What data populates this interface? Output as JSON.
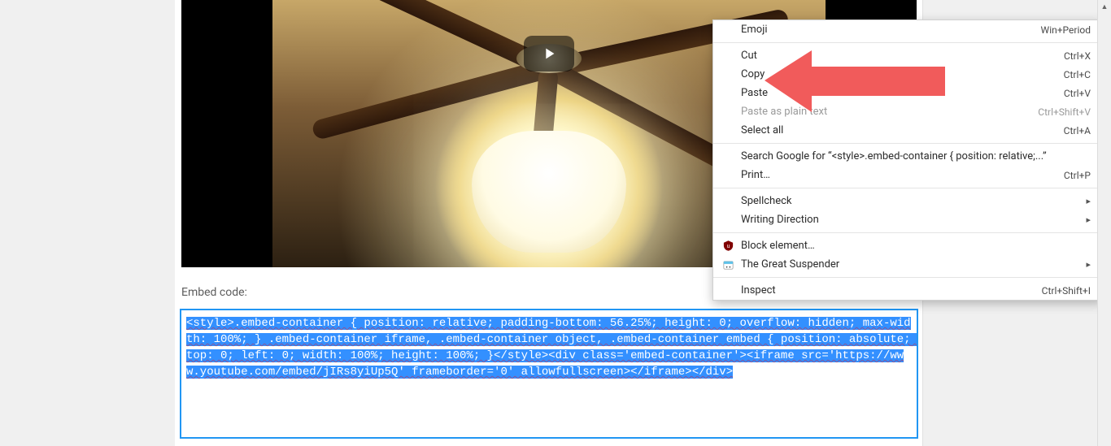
{
  "video": {
    "play_label": "Play"
  },
  "embed": {
    "label": "Embed code:",
    "code": "<style>.embed-container { position: relative; padding-bottom: 56.25%; height: 0; overflow: hidden; max-width: 100%; } .embed-container iframe, .embed-container object, .embed-container embed { position: absolute; top: 0; left: 0; width: 100%; height: 100%; }</style><div class='embed-container'><iframe src='https://www.youtube.com/embed/jIRs8yiUp5Q' frameborder='0' allowfullscreen></iframe></div>"
  },
  "context_menu": {
    "items": [
      {
        "label": "Emoji",
        "accelerator": "Win+Period",
        "interactable": true
      },
      {
        "separator": true
      },
      {
        "label": "Cut",
        "accelerator": "Ctrl+X",
        "interactable": true
      },
      {
        "label": "Copy",
        "accelerator": "Ctrl+C",
        "interactable": true
      },
      {
        "label": "Paste",
        "accelerator": "Ctrl+V",
        "interactable": true
      },
      {
        "label": "Paste as plain text",
        "accelerator": "Ctrl+Shift+V",
        "interactable": false,
        "disabled": true
      },
      {
        "label": "Select all",
        "accelerator": "Ctrl+A",
        "interactable": true
      },
      {
        "separator": true
      },
      {
        "label": "Search Google for “<style>.embed-container { position: relative;...”",
        "accelerator": "",
        "interactable": true
      },
      {
        "label": "Print…",
        "accelerator": "Ctrl+P",
        "interactable": true
      },
      {
        "separator": true
      },
      {
        "label": "Spellcheck",
        "accelerator": "",
        "interactable": true,
        "submenu": true
      },
      {
        "label": "Writing Direction",
        "accelerator": "",
        "interactable": true,
        "submenu": true
      },
      {
        "separator": true
      },
      {
        "label": "Block element…",
        "accelerator": "",
        "interactable": true,
        "icon": "ublock"
      },
      {
        "label": "The Great Suspender",
        "accelerator": "",
        "interactable": true,
        "submenu": true,
        "icon": "suspender"
      },
      {
        "separator": true
      },
      {
        "label": "Inspect",
        "accelerator": "Ctrl+Shift+I",
        "interactable": true
      }
    ]
  },
  "annotation": {
    "arrow_color": "#f15b5b",
    "points_to": "Copy"
  }
}
